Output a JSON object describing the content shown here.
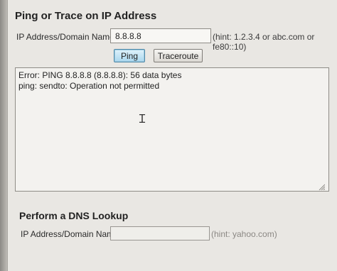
{
  "ping_section": {
    "title": "Ping or Trace on IP Address",
    "address_label": "IP Address/Domain Name:",
    "address_value": "8.8.8.8",
    "hint": "(hint: 1.2.3.4 or abc.com or fe80::10)",
    "ping_button": "Ping",
    "traceroute_button": "Traceroute",
    "output_lines": [
      "Error: PING 8.8.8.8 (8.8.8.8): 56 data bytes",
      "ping: sendto: Operation not permitted"
    ]
  },
  "dns_section": {
    "title": "Perform a DNS Lookup",
    "address_label": "IP Address/Domain Name:",
    "address_value": "",
    "hint": "(hint: yahoo.com)"
  }
}
